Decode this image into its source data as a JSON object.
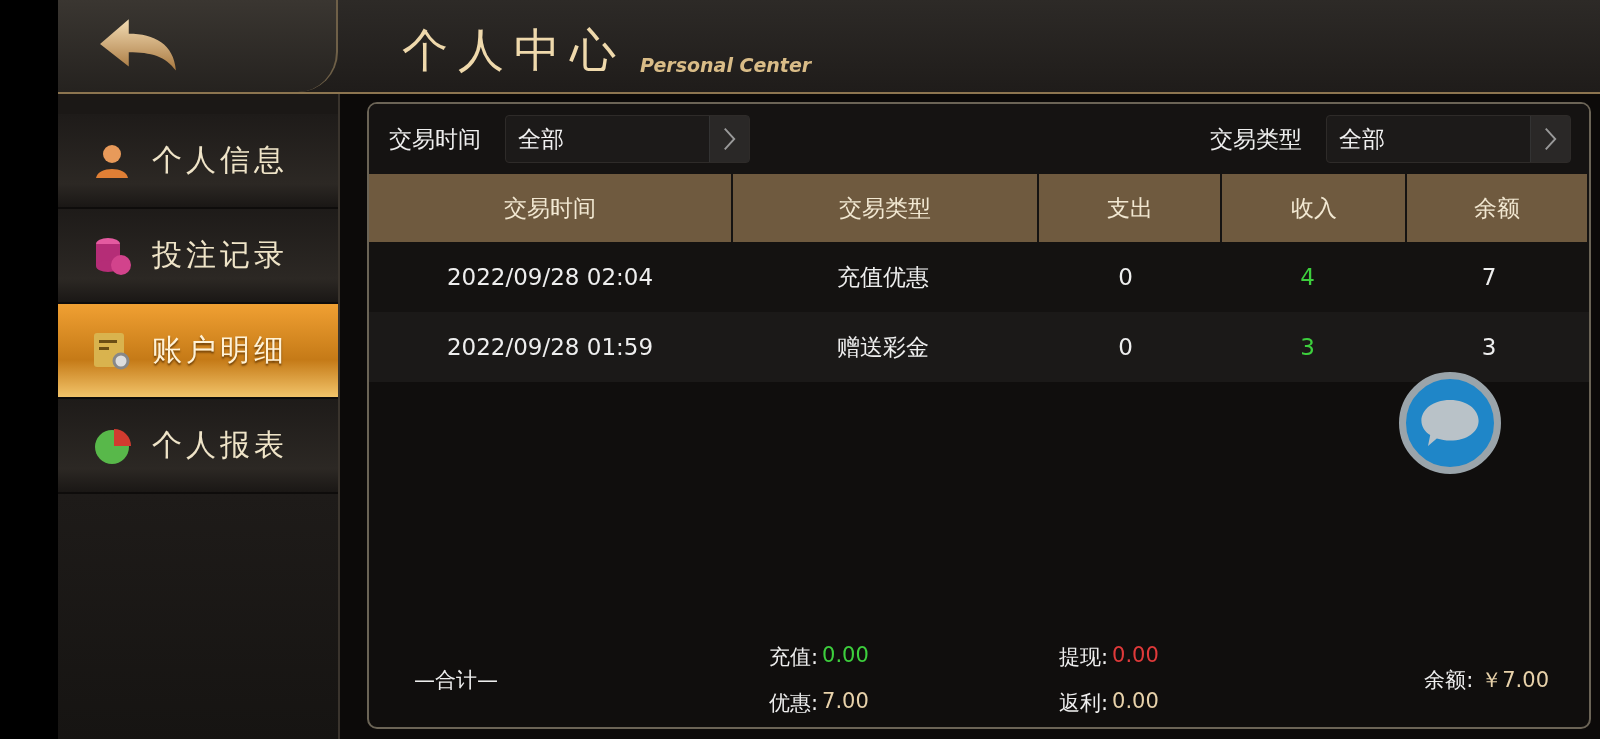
{
  "header": {
    "title": "个人中心",
    "subtitle": "Personal Center"
  },
  "sidebar": {
    "items": [
      {
        "label": "个人信息",
        "kind": "person",
        "selected": false
      },
      {
        "label": "投注记录",
        "kind": "coins",
        "selected": false
      },
      {
        "label": "账户明细",
        "kind": "ledger",
        "selected": true
      },
      {
        "label": "个人报表",
        "kind": "pie",
        "selected": false
      }
    ]
  },
  "filters": [
    {
      "label": "交易时间",
      "value": "全部"
    },
    {
      "label": "交易类型",
      "value": "全部"
    }
  ],
  "table": {
    "columns": [
      "交易时间",
      "交易类型",
      "支出",
      "收入",
      "余额"
    ],
    "rows": [
      [
        "2022/09/28 02:04",
        "充值优惠",
        "0",
        "4",
        "7"
      ],
      [
        "2022/09/28 01:59",
        "赠送彩金",
        "0",
        "3",
        "3"
      ]
    ]
  },
  "summary": {
    "label": "—合计—",
    "items": [
      {
        "label": "充值:",
        "value": "0.00",
        "kind": "positive"
      },
      {
        "label": "提现:",
        "value": "0.00",
        "kind": "negative"
      },
      {
        "label": "优惠:",
        "value": "7.00",
        "kind": "neutral"
      },
      {
        "label": "返利:",
        "value": "0.00",
        "kind": "neutral"
      }
    ],
    "balance": {
      "label": "余额:",
      "value": "￥7.00"
    }
  }
}
